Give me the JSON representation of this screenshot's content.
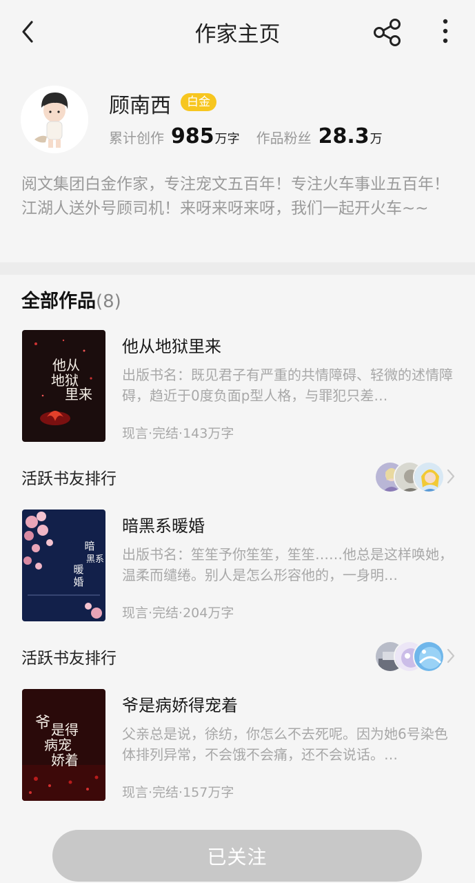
{
  "header": {
    "title": "作家主页"
  },
  "author": {
    "name": "顾南西",
    "badge": "白金",
    "stats": [
      {
        "label": "累计创作",
        "value": "985",
        "unit": "万字"
      },
      {
        "label": "作品粉丝",
        "value": "28.3",
        "unit": "万"
      }
    ],
    "bio": "阅文集团白金作家，专注宠文五百年！专注火车事业五百年！江湖人送外号顾司机！来呀来呀来呀，我们一起开火车~~"
  },
  "works": {
    "title": "全部作品",
    "count": "(8)",
    "books": [
      {
        "title": "他从地狱里来",
        "desc": "出版书名：既见君子有严重的共情障碍、轻微的述情障碍，趋近于0度负面p型人格，与罪犯只差…",
        "meta": "现言·完结·143万字",
        "cover_text": "他从地狱里来"
      },
      {
        "title": "暗黑系暖婚",
        "desc": "出版书名：笙笙予你笙笙，笙笙……他总是这样唤她，温柔而缱绻。别人是怎么形容他的，一身明…",
        "meta": "现言·完结·204万字",
        "cover_text": "暗黑系暖婚"
      },
      {
        "title": "爷是病娇得宠着",
        "desc": "父亲总是说，徐纺，你怎么不去死呢。因为她6号染色体排列异常，不会饿不会痛，还不会说话。…",
        "meta": "现言·完结·157万字",
        "cover_text": "爷是病娇得宠着"
      }
    ],
    "rank_label": "活跃书友排行"
  },
  "follow_button": "已关注",
  "colors": {
    "badge": "#f7c61f",
    "follow_button": "#c8c8c8",
    "muted_text": "#a8a8a8"
  }
}
